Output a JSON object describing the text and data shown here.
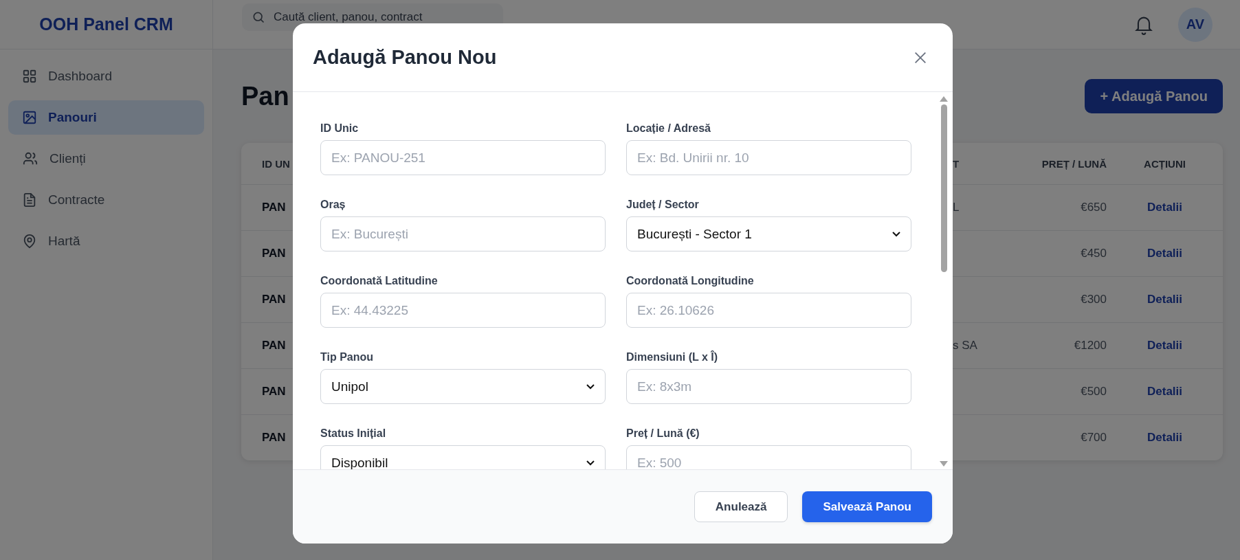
{
  "app": {
    "logo": "OOH Panel CRM"
  },
  "sidebar": {
    "items": [
      {
        "label": "Dashboard",
        "selected": false
      },
      {
        "label": "Panouri",
        "selected": true
      },
      {
        "label": "Clienți",
        "selected": false
      },
      {
        "label": "Contracte",
        "selected": false
      },
      {
        "label": "Hartă",
        "selected": false
      }
    ]
  },
  "topbar": {
    "search": {
      "placeholder": "Caută client, panou, contract"
    },
    "avatar": "AV"
  },
  "page": {
    "title": "Pan",
    "add_button": "+ Adaugă Panou"
  },
  "table": {
    "columns": [
      "ID UN",
      "T",
      "PREȚ / LUNĂ",
      "ACȚIUNI"
    ],
    "rows": [
      {
        "id": "PAN",
        "column_2": "L",
        "price": "€650",
        "action": "Detalii"
      },
      {
        "id": "PAN",
        "price": "€450",
        "action": "Detalii"
      },
      {
        "id": "PAN",
        "price": "€300",
        "action": "Detalii"
      },
      {
        "id": "PAN",
        "column_2": "s SA",
        "price": "€1200",
        "action": "Detalii"
      },
      {
        "id": "PAN",
        "price": "€500",
        "action": "Detalii"
      },
      {
        "id": "PAN",
        "price": "€700",
        "action": "Detalii"
      }
    ]
  },
  "modal": {
    "title": "Adaugă Panou Nou",
    "fields": [
      {
        "label": "ID Unic",
        "kind": "input",
        "placeholder": "Ex: PANOU-251"
      },
      {
        "label": "Locație / Adresă",
        "kind": "input",
        "placeholder": "Ex: Bd. Unirii nr. 10"
      },
      {
        "label": "Oraș",
        "kind": "input",
        "placeholder": "Ex: București"
      },
      {
        "label": "Județ / Sector",
        "kind": "select",
        "value": "București - Sector 1"
      },
      {
        "label": "Coordonată Latitudine",
        "kind": "input",
        "placeholder": "Ex: 44.43225"
      },
      {
        "label": "Coordonată Longitudine",
        "kind": "input",
        "placeholder": "Ex: 26.10626"
      },
      {
        "label": "Tip Panou",
        "kind": "select",
        "value": "Unipol"
      },
      {
        "label": "Dimensiuni (L x Î)",
        "kind": "input",
        "placeholder": "Ex: 8x3m"
      },
      {
        "label": "Status Inițial",
        "kind": "select",
        "value": "Disponibil"
      },
      {
        "label": "Preț / Lună (€)",
        "kind": "input",
        "placeholder": "Ex: 500"
      }
    ],
    "buttons": [
      {
        "label": "Anulează",
        "kind": "secondary"
      },
      {
        "label": "Salvează Panou",
        "kind": "primary"
      }
    ]
  }
}
